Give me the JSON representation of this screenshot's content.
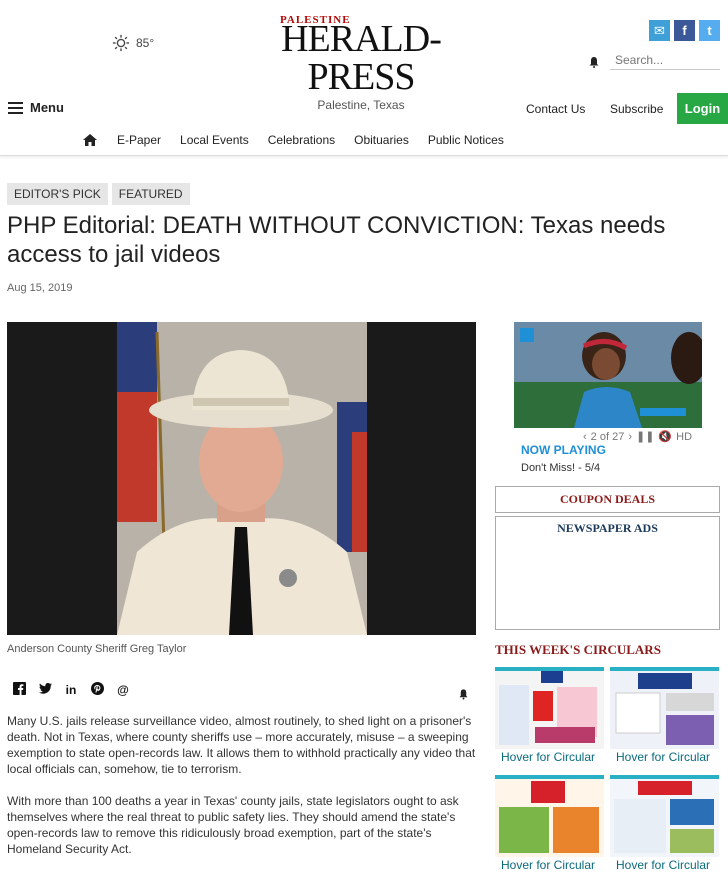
{
  "header": {
    "temperature": "85°",
    "logo_top": "PALESTINE",
    "logo_main": "HERALD-PRESS",
    "logo_sub": "Palestine, Texas",
    "search_placeholder": "Search...",
    "menu_label": "Menu",
    "contact_label": "Contact Us",
    "subscribe_label": "Subscribe",
    "login_label": "Login"
  },
  "nav": {
    "items": [
      "E-Paper",
      "Local Events",
      "Celebrations",
      "Obituaries",
      "Public Notices"
    ]
  },
  "article": {
    "tags": [
      "EDITOR'S PICK",
      "FEATURED"
    ],
    "headline": "PHP Editorial: DEATH WITHOUT CONVICTION: Texas needs access to jail videos",
    "date": "Aug 15, 2019",
    "caption": "Anderson County Sheriff Greg Taylor",
    "paragraphs": [
      "Many U.S. jails release surveillance video, almost routinely, to shed light on a prisoner's death. Not in Texas, where county sheriffs use – more accurately, misuse – a sweeping exemption to state open-records law. It allows them to withhold practically any video that local officials can, somehow, tie to terrorism.",
      "With more than 100 deaths a year in Texas' county jails, state legislators  ought to ask themselves where the real threat to public safety lies. They should amend the state's open-records law to remove this ridiculously broad exemption, part of the state's Homeland Security Act."
    ]
  },
  "sidebar": {
    "video_counter": "2 of 27",
    "video_hd": "HD",
    "now_playing": "NOW PLAYING",
    "video_title": "Don't Miss! - 5/4",
    "coupon_label": "COUPON DEALS",
    "newspaper_ads_label": "NEWSPAPER ADS",
    "circulars_title": "THIS WEEK'S CIRCULARS",
    "circulars": [
      "Hover for Circular",
      "Hover for Circular",
      "Hover for Circular",
      "Hover for Circular"
    ]
  },
  "colors": {
    "login": "#28a745",
    "accent_blue": "#1f8fd6",
    "circular_red": "#8b1a1a",
    "circular_teal": "#2ab0c4"
  }
}
